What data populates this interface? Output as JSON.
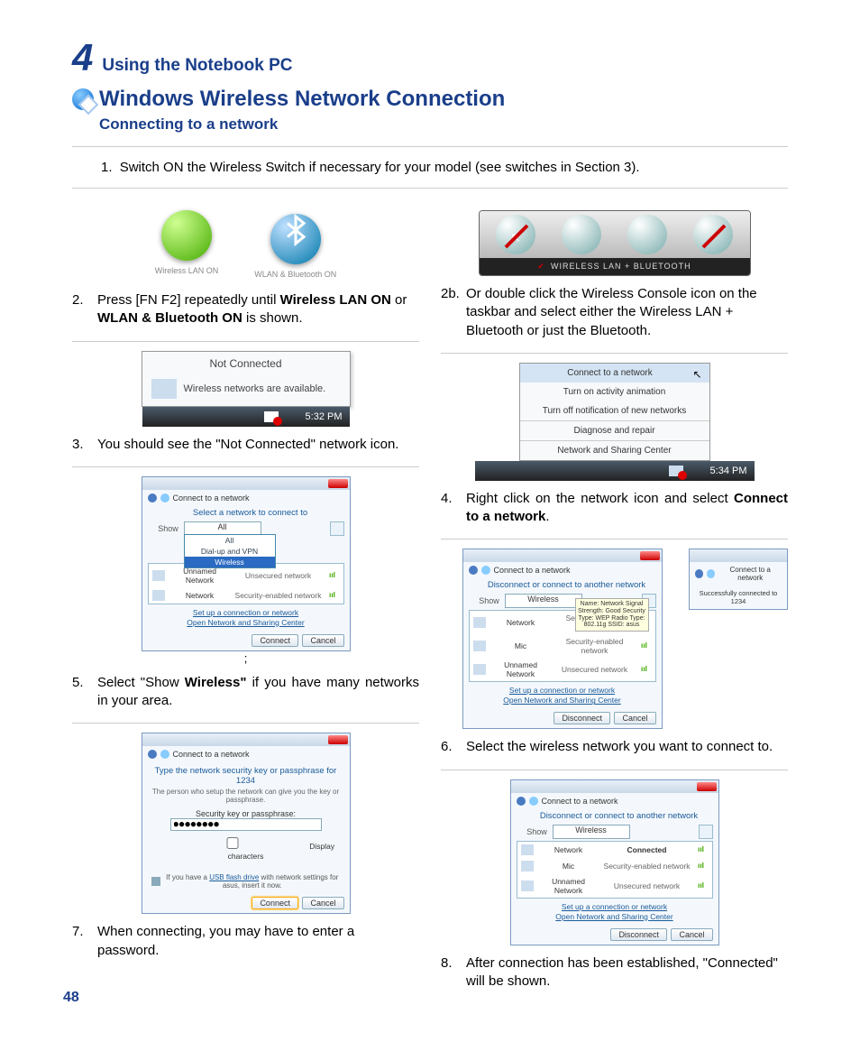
{
  "chapter": {
    "number": "4",
    "label": "Using the Notebook PC"
  },
  "title": "Windows Wireless Network Connection",
  "subtitle": "Connecting to a network",
  "step1": {
    "num": "1.",
    "text": "Switch ON the Wireless Switch if necessary for your model (see switches in Section 3)."
  },
  "left": {
    "s2": {
      "num": "2.",
      "pre": "Press [FN F2] repeatedly until ",
      "b1": "Wireless LAN ON",
      "mid": " or ",
      "b2": "WLAN & Bluetooth ON",
      "post": " is shown.",
      "orb1": "Wireless LAN ON",
      "orb2": "WLAN & Bluetooth ON"
    },
    "s3": {
      "num": "3.",
      "text": "You should see the \"Not Connected\" network icon.",
      "tt_title": "Not Connected",
      "tt_body": "Wireless networks are available.",
      "time": "5:32 PM"
    },
    "s5": {
      "num": "5.",
      "pre": "Select \"Show ",
      "b": "Wireless\"",
      "post": " if you have many networks in your area.",
      "dlg_title": "Connect to a network",
      "head": "Select a network to connect to",
      "show": "Show",
      "opt_all": "All",
      "opt_dial": "Dial-up and VPN",
      "opt_sel": "Wireless",
      "rows": [
        {
          "c1": "Unnamed Network",
          "c2": "Unsecured network"
        },
        {
          "c1": "Network",
          "c2": "Security-enabled network"
        }
      ],
      "link1": "Set up a connection or network",
      "link2": "Open Network and Sharing Center",
      "connect": "Connect",
      "cancel": "Cancel"
    },
    "s7": {
      "num": "7.",
      "text": "When connecting, you may have to enter a password.",
      "dlg_title": "Connect to a network",
      "t1": "Type the network security key or passphrase for 1234",
      "t2": "The person who setup the network can give you the key or passphrase.",
      "lbl": "Security key or passphrase:",
      "value": "●●●●●●●●",
      "chk": "Display characters",
      "note_pre": "If you have a ",
      "note_link": "USB flash drive",
      "note_post": " with network settings for asus, insert it now.",
      "connect": "Connect",
      "cancel": "Cancel"
    }
  },
  "right": {
    "s2b": {
      "num": "2b.",
      "text": "Or double click the Wireless Console icon on the taskbar and select either the Wireless LAN + Bluetooth or just the Bluetooth.",
      "bar": "WIRELESS LAN + BLUETOOTH"
    },
    "s4": {
      "num": "4.",
      "pre": "Right click on the network icon and select ",
      "b": "Connect to a network",
      "post": ".",
      "menu": [
        "Connect to a network",
        "Turn on activity animation",
        "Turn off notification of new networks",
        "Diagnose and repair",
        "Network and Sharing Center"
      ],
      "time": "5:34 PM"
    },
    "s6": {
      "num": "6.",
      "text": "Select the wireless network you want to connect to.",
      "dlg_title": "Connect to a network",
      "head": "Disconnect or connect to another network",
      "show": "Show",
      "opt": "Wireless",
      "rows": [
        {
          "c1": "Network",
          "c2": "Security-enabled network"
        },
        {
          "c1": "Mic",
          "c2": "Security-enabled network"
        },
        {
          "c1": "Unnamed Network",
          "c2": "Unsecured network"
        }
      ],
      "tip": "Name: Network\nSignal Strength: Good\nSecurity Type: WEP\nRadio Type: 802.11g\nSSID: asus",
      "link1": "Set up a connection or network",
      "link2": "Open Network and Sharing Center",
      "disconnect": "Disconnect",
      "cancel": "Cancel",
      "side_title": "Connect to a network",
      "side_text": "Successfully connected to 1234"
    },
    "s8": {
      "num": "8.",
      "text": "After connection has been established, \"Connected\" will be shown.",
      "dlg_title": "Connect to a network",
      "head": "Disconnect or connect to another network",
      "show": "Show",
      "opt": "Wireless",
      "rows": [
        {
          "c1": "Network",
          "c2": "Connected"
        },
        {
          "c1": "Mic",
          "c2": "Security-enabled network"
        },
        {
          "c1": "Unnamed Network",
          "c2": "Unsecured network"
        }
      ],
      "link1": "Set up a connection or network",
      "link2": "Open Network and Sharing Center",
      "disconnect": "Disconnect",
      "cancel": "Cancel"
    }
  },
  "page_num": "48"
}
